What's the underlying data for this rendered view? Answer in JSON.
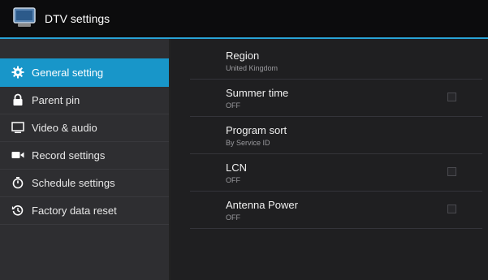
{
  "header": {
    "title": "DTV settings",
    "icon": "tv-icon"
  },
  "sidebar": {
    "items": [
      {
        "label": "General setting",
        "icon": "gear-icon",
        "active": true
      },
      {
        "label": "Parent pin",
        "icon": "lock-icon",
        "active": false
      },
      {
        "label": "Video & audio",
        "icon": "monitor-icon",
        "active": false
      },
      {
        "label": "Record settings",
        "icon": "video-camera-icon",
        "active": false
      },
      {
        "label": "Schedule settings",
        "icon": "stopwatch-icon",
        "active": false
      },
      {
        "label": "Factory data reset",
        "icon": "restore-icon",
        "active": false
      }
    ]
  },
  "settings": {
    "rows": [
      {
        "title": "Region",
        "value": "United Kingdom",
        "has_checkbox": false
      },
      {
        "title": "Summer time",
        "value": "OFF",
        "has_checkbox": true,
        "checked": false
      },
      {
        "title": "Program sort",
        "value": "By Service ID",
        "has_checkbox": false
      },
      {
        "title": "LCN",
        "value": "OFF",
        "has_checkbox": true,
        "checked": false
      },
      {
        "title": "Antenna Power",
        "value": "OFF",
        "has_checkbox": true,
        "checked": false
      }
    ]
  },
  "colors": {
    "accent": "#29a3d6",
    "active_item": "#1896c9",
    "sidebar_bg": "#2e2e31",
    "main_bg": "#1f1f21",
    "titlebar_bg": "#0c0c0d"
  }
}
